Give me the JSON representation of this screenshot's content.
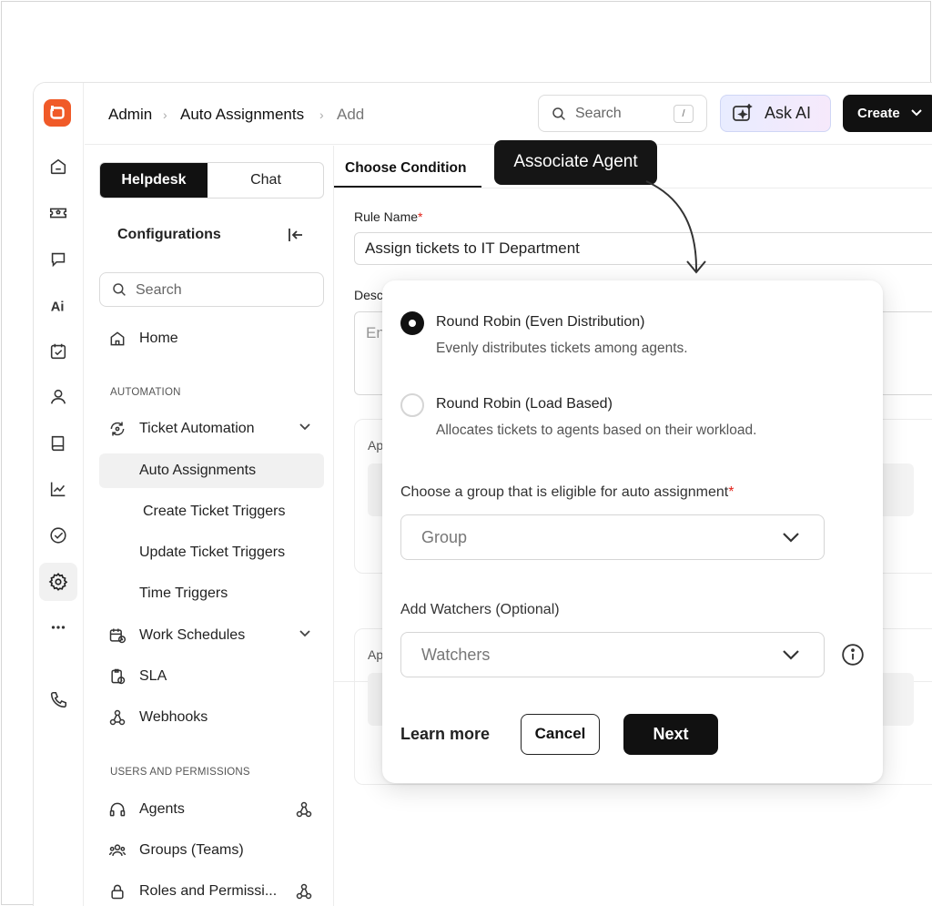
{
  "breadcrumb": {
    "root": "Admin",
    "section": "Auto Assignments",
    "current": "Add"
  },
  "topbar": {
    "search_placeholder": "Search",
    "search_shortcut": "/",
    "ask_ai_label": "Ask AI",
    "create_label": "Create"
  },
  "sidebar": {
    "tabs": [
      "Helpdesk",
      "Chat"
    ],
    "title": "Configurations",
    "search_placeholder": "Search",
    "home": "Home",
    "section_automation": "AUTOMATION",
    "items": [
      "Ticket Automation",
      "Auto Assignments",
      "Create Ticket Triggers",
      "Update Ticket Triggers",
      "Time Triggers",
      "Work Schedules",
      "SLA",
      "Webhooks"
    ],
    "section_users": "USERS AND PERMISSIONS",
    "user_items": [
      "Agents",
      "Groups (Teams)",
      "Roles and Permissi..."
    ]
  },
  "main": {
    "tab": "Choose Condition",
    "rule_name_label": "Rule Name",
    "rule_name_value": "Assign tickets to IT Department",
    "description_label": "Desc",
    "description_placeholder": "En",
    "card_label_1": "Ap",
    "card_label_2": "Ap"
  },
  "tooltip": {
    "label": "Associate Agent"
  },
  "dialog": {
    "option1_title": "Round Robin (Even Distribution)",
    "option1_desc": "Evenly distributes tickets among agents.",
    "option2_title": "Round Robin (Load Based)",
    "option2_desc": "Allocates tickets to agents based on their workload.",
    "group_label": "Choose a group that is eligible for auto assignment",
    "group_placeholder": "Group",
    "watchers_label": "Add Watchers (Optional)",
    "watchers_placeholder": "Watchers",
    "learn_more": "Learn more",
    "cancel": "Cancel",
    "next": "Next"
  },
  "colors": {
    "brand": "#f05a28",
    "primary": "#111111",
    "required": "#e2231a"
  }
}
